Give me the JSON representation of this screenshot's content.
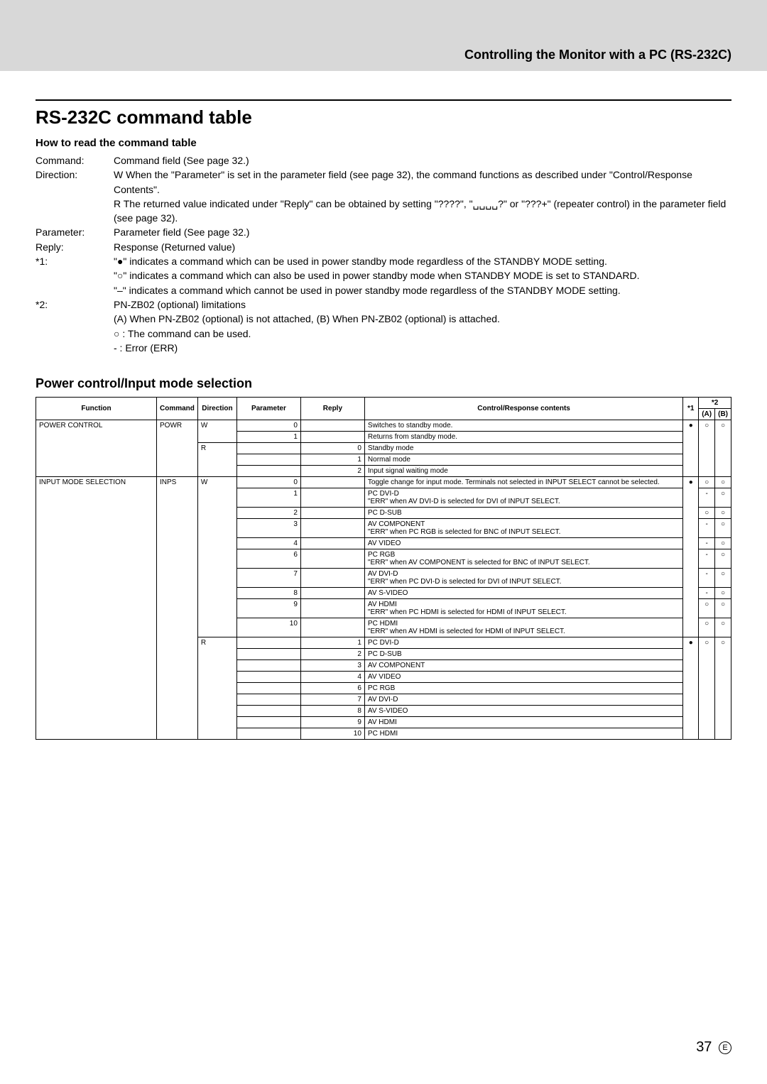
{
  "header": {
    "breadcrumb": "Controlling the Monitor with a PC (RS-232C)"
  },
  "title": "RS-232C command table",
  "howTo": {
    "heading": "How to read the command table",
    "rows": [
      {
        "label": "Command:",
        "value": "Command field (See page 32.)"
      },
      {
        "label": "Direction:",
        "value": "W  When the \"Parameter\" is set in the parameter field (see page 32), the command functions as described under \"Control/Response Contents\"."
      },
      {
        "label": "",
        "value": "R  The returned value indicated under \"Reply\" can be obtained by setting \"????\", \"␣␣␣␣?\" or \"???+\" (repeater control) in the parameter field (see page 32)."
      },
      {
        "label": "Parameter:",
        "value": "Parameter field (See page 32.)"
      },
      {
        "label": "Reply:",
        "value": "Response (Returned value)"
      },
      {
        "label": "*1:",
        "value": "\"●\" indicates a command which can be used in power standby mode regardless of the STANDBY MODE setting."
      },
      {
        "label": "",
        "value": "\"○\" indicates a command which can also be used in power standby mode when STANDBY MODE is set to STANDARD."
      },
      {
        "label": "",
        "value": "\"–\" indicates a command which cannot be used in power standby mode regardless of the STANDBY MODE setting."
      },
      {
        "label": "*2:",
        "value": "PN-ZB02 (optional) limitations"
      },
      {
        "label": "",
        "value": "(A) When PN-ZB02 (optional) is not attached, (B) When PN-ZB02 (optional) is attached."
      },
      {
        "label": "",
        "value": "○ : The command can be used."
      },
      {
        "label": "",
        "value": "-  : Error (ERR)"
      }
    ]
  },
  "section_title": "Power control/Input mode selection",
  "table": {
    "headers": {
      "function": "Function",
      "command": "Command",
      "direction": "Direction",
      "parameter": "Parameter",
      "reply": "Reply",
      "contents": "Control/Response contents",
      "s1": "*1",
      "s2": "*2",
      "a": "(A)",
      "b": "(B)"
    },
    "power": {
      "func": "POWER CONTROL",
      "cmd": "POWR",
      "w": [
        {
          "param": "0",
          "contents": "Switches to standby mode."
        },
        {
          "param": "1",
          "contents": "Returns from standby mode."
        }
      ],
      "r": [
        {
          "reply": "0",
          "contents": "Standby mode"
        },
        {
          "reply": "1",
          "contents": "Normal mode"
        },
        {
          "reply": "2",
          "contents": "Input signal waiting mode"
        }
      ],
      "s1": "●",
      "a": "○",
      "b": "○"
    },
    "input": {
      "func": "INPUT MODE SELECTION",
      "cmd": "INPS",
      "w": [
        {
          "param": "0",
          "contents": "Toggle change for input mode. Terminals not selected in INPUT SELECT cannot be selected.",
          "a": "○",
          "b": "○"
        },
        {
          "param": "1",
          "contents": "PC DVI-D\n\"ERR\" when AV DVI-D is selected for DVI of INPUT SELECT.",
          "a": "-",
          "b": "○"
        },
        {
          "param": "2",
          "contents": "PC D-SUB",
          "a": "○",
          "b": "○"
        },
        {
          "param": "3",
          "contents": "AV COMPONENT\n\"ERR\" when PC RGB is selected for BNC of INPUT SELECT.",
          "a": "-",
          "b": "○"
        },
        {
          "param": "4",
          "contents": "AV VIDEO",
          "a": "-",
          "b": "○"
        },
        {
          "param": "6",
          "contents": "PC RGB\n\"ERR\" when AV COMPONENT is selected for BNC of INPUT SELECT.",
          "a": "-",
          "b": "○"
        },
        {
          "param": "7",
          "contents": "AV DVI-D\n\"ERR\" when PC DVI-D is selected for DVI of INPUT SELECT.",
          "a": "-",
          "b": "○"
        },
        {
          "param": "8",
          "contents": "AV S-VIDEO",
          "a": "-",
          "b": "○"
        },
        {
          "param": "9",
          "contents": "AV HDMI\n\"ERR\" when PC HDMI is selected for HDMI of INPUT SELECT.",
          "a": "○",
          "b": "○"
        },
        {
          "param": "10",
          "contents": "PC HDMI\n\"ERR\" when AV HDMI is selected for HDMI of INPUT SELECT.",
          "a": "○",
          "b": "○"
        }
      ],
      "w_s1": "●",
      "r": [
        {
          "reply": "1",
          "contents": "PC DVI-D"
        },
        {
          "reply": "2",
          "contents": "PC D-SUB"
        },
        {
          "reply": "3",
          "contents": "AV COMPONENT"
        },
        {
          "reply": "4",
          "contents": "AV VIDEO"
        },
        {
          "reply": "6",
          "contents": "PC RGB"
        },
        {
          "reply": "7",
          "contents": "AV DVI-D"
        },
        {
          "reply": "8",
          "contents": "AV S-VIDEO"
        },
        {
          "reply": "9",
          "contents": "AV HDMI"
        },
        {
          "reply": "10",
          "contents": "PC HDMI"
        }
      ],
      "r_s1": "●",
      "r_a": "○",
      "r_b": "○"
    }
  },
  "footer": {
    "page": "37",
    "e": "E"
  }
}
